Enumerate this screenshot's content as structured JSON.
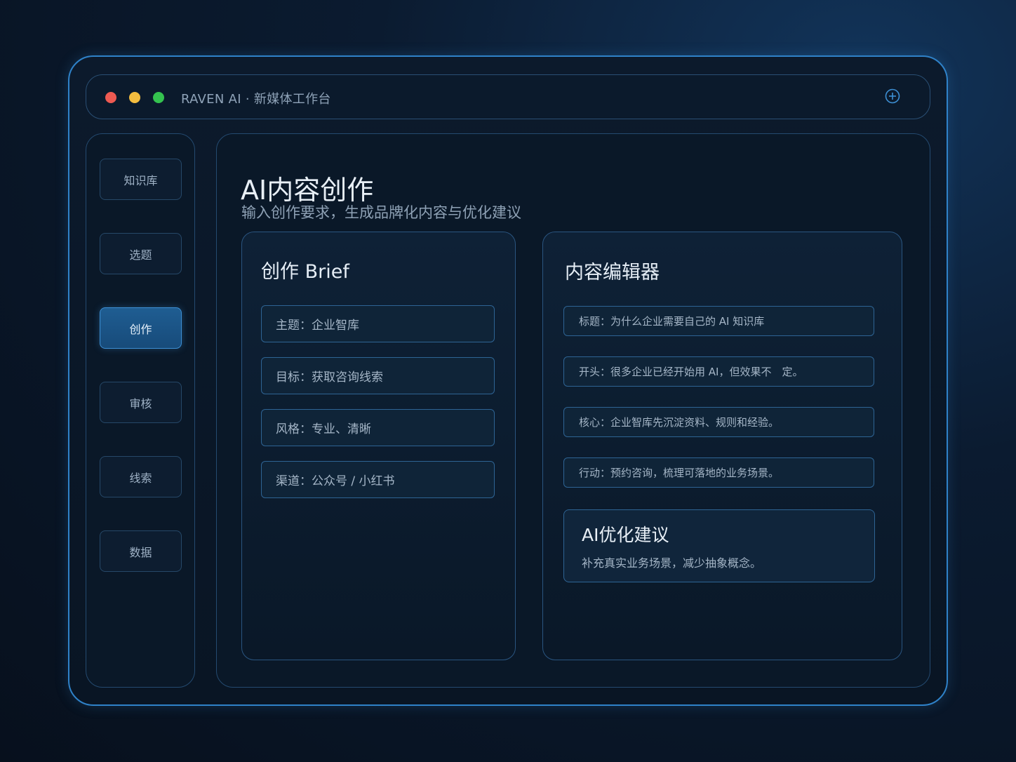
{
  "window": {
    "title": "RAVEN AI · 新媒体工作台",
    "icons": [
      "close-dot",
      "minimize-dot",
      "maximize-dot",
      "plus-circle-icon"
    ]
  },
  "sidebar": {
    "items": [
      {
        "label": "知识库",
        "active": false
      },
      {
        "label": "选题",
        "active": false
      },
      {
        "label": "创作",
        "active": true
      },
      {
        "label": "审核",
        "active": false
      },
      {
        "label": "线索",
        "active": false
      },
      {
        "label": "数据",
        "active": false
      }
    ]
  },
  "main": {
    "title": "AI内容创作",
    "subtitle": "输入创作要求，生成品牌化内容与优化建议",
    "brief": {
      "title": "创作 Brief",
      "fields": [
        "主题：企业智库",
        "目标：获取咨询线索",
        "风格：专业、清晰",
        "渠道：公众号 / 小红书"
      ]
    },
    "editor": {
      "title": "内容编辑器",
      "fields": [
        "标题：为什么企业需要自己的 AI 知识库",
        "开头：很多企业已经开始用 AI，但效果不　定。",
        "核心：企业智库先沉淀资料、规则和经验。",
        "行动：预约咨询，梳理可落地的业务场景。"
      ],
      "suggestion": {
        "title": "AI优化建议",
        "body": "补充真实业务场景，减少抽象概念。"
      }
    }
  },
  "colors": {
    "accent": "#2f82c9",
    "active_nav": "#1f5d92",
    "background": "#0a1828",
    "traffic_red": "#ee5a52",
    "traffic_yellow": "#f4bd3f",
    "traffic_green": "#34c24f"
  }
}
